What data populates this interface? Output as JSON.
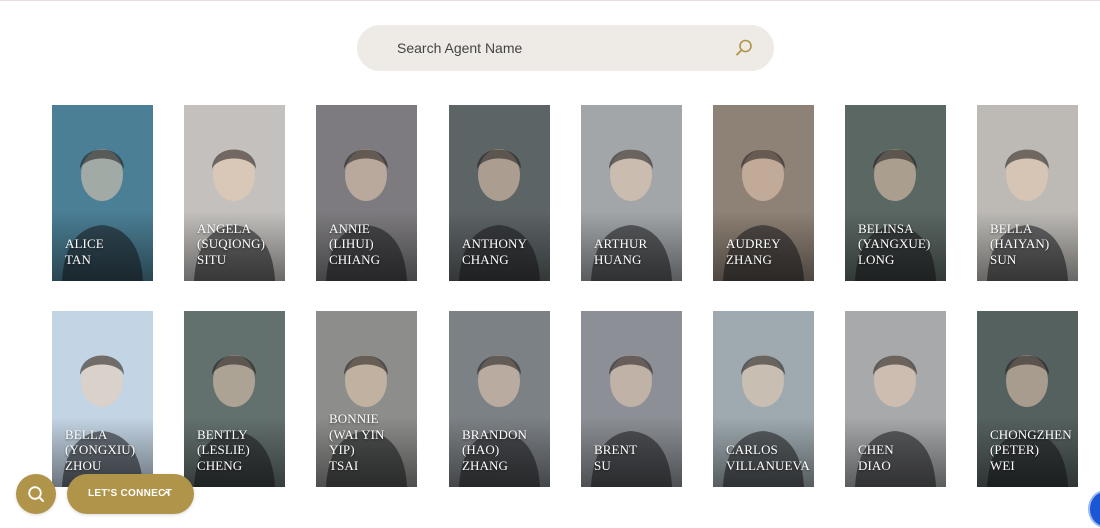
{
  "search": {
    "placeholder": "Search Agent Name",
    "icon": "search-icon"
  },
  "agents_row1": [
    {
      "lines": [
        "ALICE",
        "TAN"
      ],
      "bg": "#4b7f95"
    },
    {
      "lines": [
        "ANGELA",
        "(SUQIONG)",
        "SITU"
      ],
      "bg": "#c3c0bd"
    },
    {
      "lines": [
        "ANNIE",
        "(LIHUI)",
        "CHIANG"
      ],
      "bg": "#7d7b7f"
    },
    {
      "lines": [
        "ANTHONY",
        "CHANG"
      ],
      "bg": "#5d6466"
    },
    {
      "lines": [
        "ARTHUR",
        "HUANG"
      ],
      "bg": "#a2a6a9"
    },
    {
      "lines": [
        "AUDREY",
        "ZHANG"
      ],
      "bg": "#8e8175"
    },
    {
      "lines": [
        "BELINSA",
        "(YANGXUE)",
        "LONG"
      ],
      "bg": "#5b6763"
    },
    {
      "lines": [
        "BELLA",
        "(HAIYAN)",
        "SUN"
      ],
      "bg": "#bdbab6"
    }
  ],
  "agents_row2": [
    {
      "lines": [
        "BELLA",
        "(YONGXIU)",
        "ZHOU"
      ],
      "bg": "#c3d4e4"
    },
    {
      "lines": [
        "BENTLY",
        "(LESLIE)",
        "CHENG"
      ],
      "bg": "#62706e"
    },
    {
      "lines": [
        "BONNIE",
        "(WAI YIN",
        "YIP)",
        "TSAI"
      ],
      "bg": "#8d8e8b"
    },
    {
      "lines": [
        "BRANDON",
        "(HAO)",
        "ZHANG"
      ],
      "bg": "#7c8186"
    },
    {
      "lines": [
        "BRENT",
        "SU"
      ],
      "bg": "#8c9096"
    },
    {
      "lines": [
        "CARLOS",
        "VILLANUEVA"
      ],
      "bg": "#9eaab0"
    },
    {
      "lines": [
        "CHEN",
        "DIAO"
      ],
      "bg": "#a7a9aa"
    },
    {
      "lines": [
        "CHONGZHEN",
        "(PETER)",
        "WEI"
      ],
      "bg": "#55615f"
    }
  ],
  "floating": {
    "search_icon": "search-icon",
    "connect_label": "LET'S CONNECT",
    "connect_icon": "chevron-up-icon",
    "recaptcha_icon": "recaptcha-icon"
  },
  "colors": {
    "accent": "#b0944a",
    "search_bg": "#eeeae6",
    "recaptcha": "#1a56d6"
  }
}
